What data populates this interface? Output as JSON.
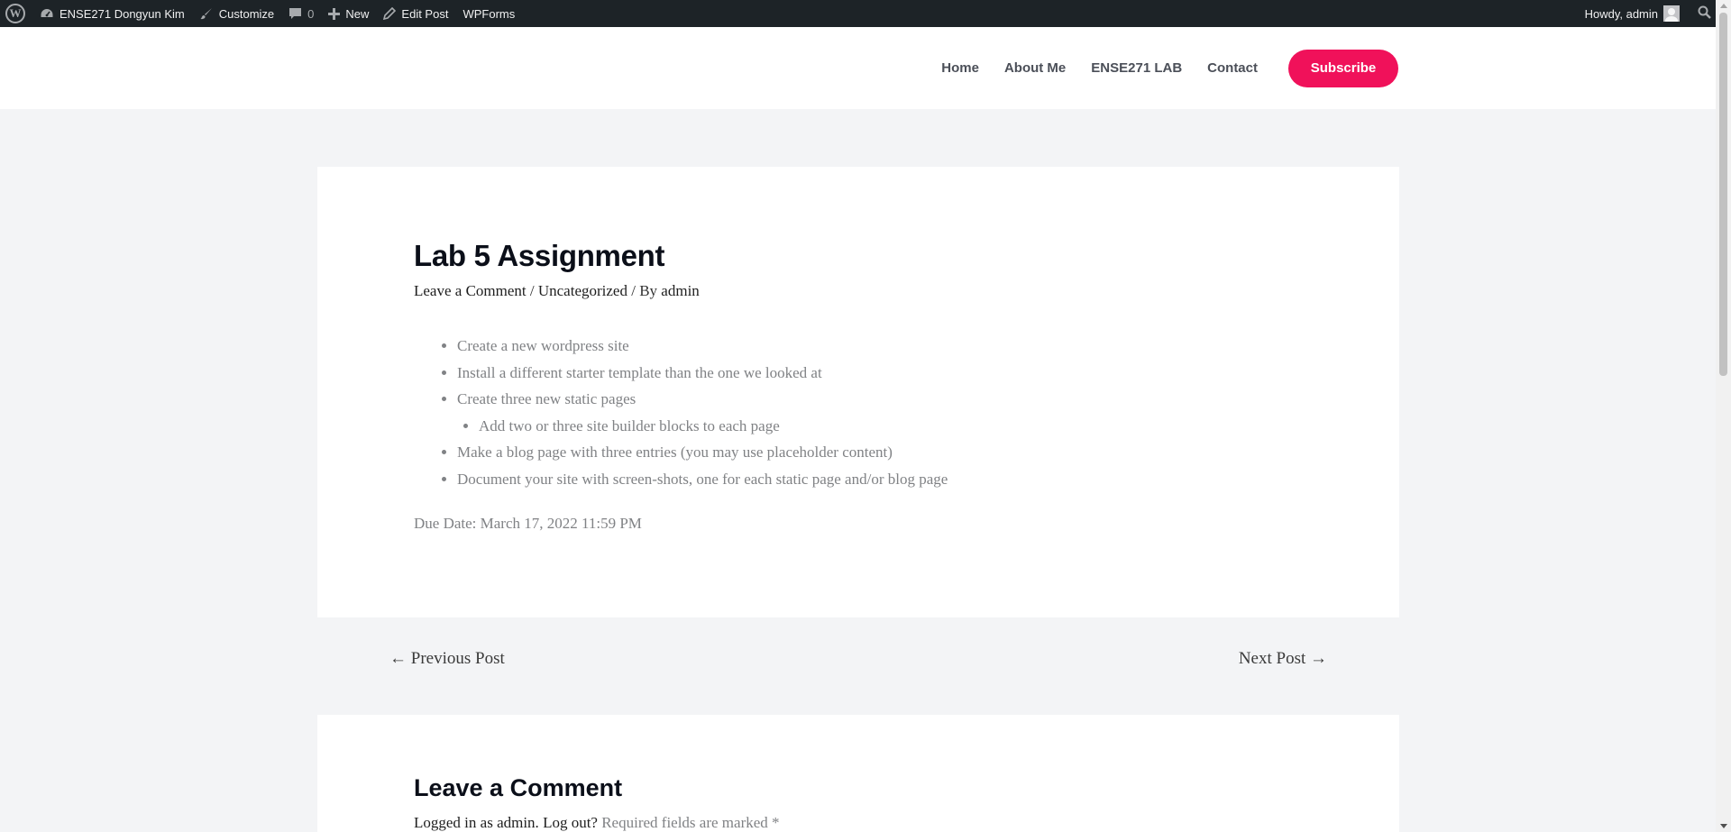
{
  "admin_bar": {
    "site_name": "ENSE271 Dongyun Kim",
    "customize": "Customize",
    "comments_count": "0",
    "new": "New",
    "edit_post": "Edit Post",
    "wpforms": "WPForms",
    "howdy": "Howdy, admin"
  },
  "nav": {
    "items": [
      "Home",
      "About Me",
      "ENSE271 LAB",
      "Contact"
    ],
    "subscribe": "Subscribe"
  },
  "post": {
    "title": "Lab 5 Assignment",
    "meta": {
      "comment_link": "Leave a Comment",
      "sep1": " / ",
      "category": "Uncategorized",
      "sep2": " / By ",
      "author": "admin"
    },
    "list": [
      "Create a new wordpress site",
      "Install a different starter template than the one we looked at",
      "Create three new static pages"
    ],
    "sub_list": [
      "Add two or three site builder blocks to each page"
    ],
    "list_after": [
      "Make a blog page with three entries (you may use placeholder content)",
      "Document your site with screen-shots, one for each static page and/or blog page"
    ],
    "due_date": "Due Date: March 17, 2022 11:59 PM"
  },
  "post_nav": {
    "previous": "← Previous Post",
    "next": "Next Post →"
  },
  "comments": {
    "title": "Leave a Comment",
    "logged_in": "Logged in as admin.",
    "log_out": "Log out?",
    "required": "Required fields are marked *"
  },
  "colors": {
    "accent": "#f0115a",
    "admin_bar_bg": "#1d2327",
    "page_bg": "#f3f4f6"
  },
  "icons": {
    "wp_logo": "wordpress-logo-icon",
    "site": "dashboard-icon",
    "customize": "paintbrush-icon",
    "comments": "comment-bubble-icon",
    "new": "plus-icon",
    "edit": "pencil-icon",
    "search": "search-icon"
  }
}
